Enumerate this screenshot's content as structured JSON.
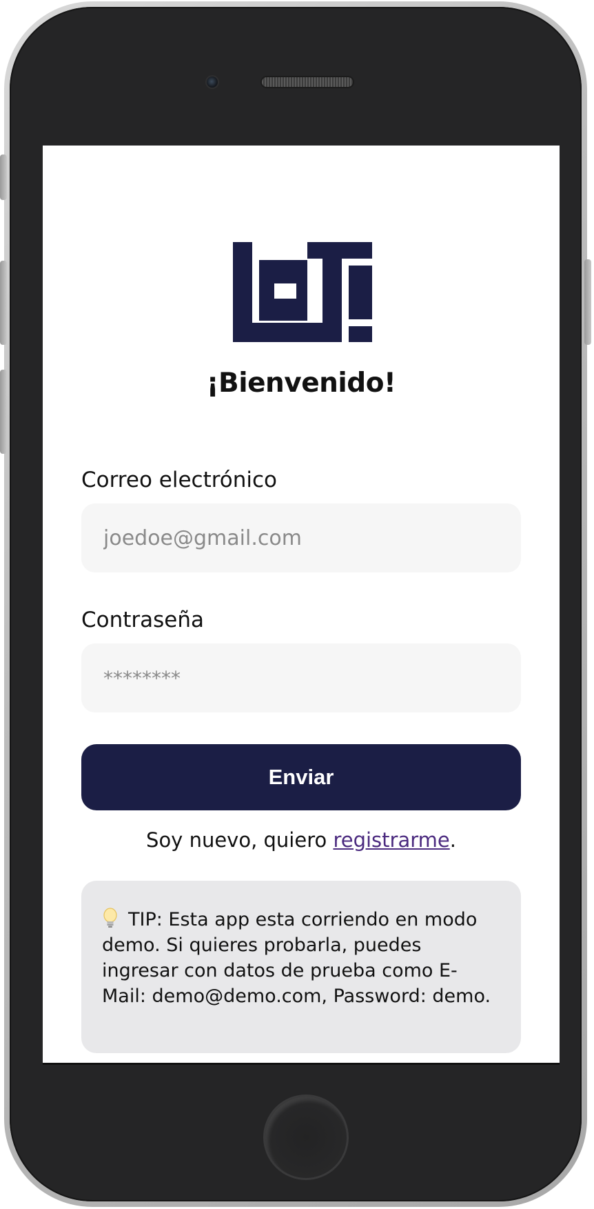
{
  "app": {
    "welcome_title": "¡Bienvenido!",
    "logo_alt": "LOTI"
  },
  "form": {
    "email_label": "Correo electrónico",
    "email_placeholder": "joedoe@gmail.com",
    "password_label": "Contraseña",
    "password_placeholder": "********",
    "submit_label": "Enviar"
  },
  "register": {
    "prefix": "Soy nuevo, quiero ",
    "link_text": "registrarme",
    "suffix": "."
  },
  "tip": {
    "icon": "lightbulb-icon",
    "text": "TIP: Esta app esta corriendo en modo demo. Si quieres probarla, puedes ingresar con datos de prueba como E-Mail: demo@demo.com, Password: demo."
  },
  "colors": {
    "brand_navy": "#1b1e45",
    "link_purple": "#4b2a7f",
    "tip_background": "#e8e8ea",
    "input_background": "#f6f6f6"
  }
}
